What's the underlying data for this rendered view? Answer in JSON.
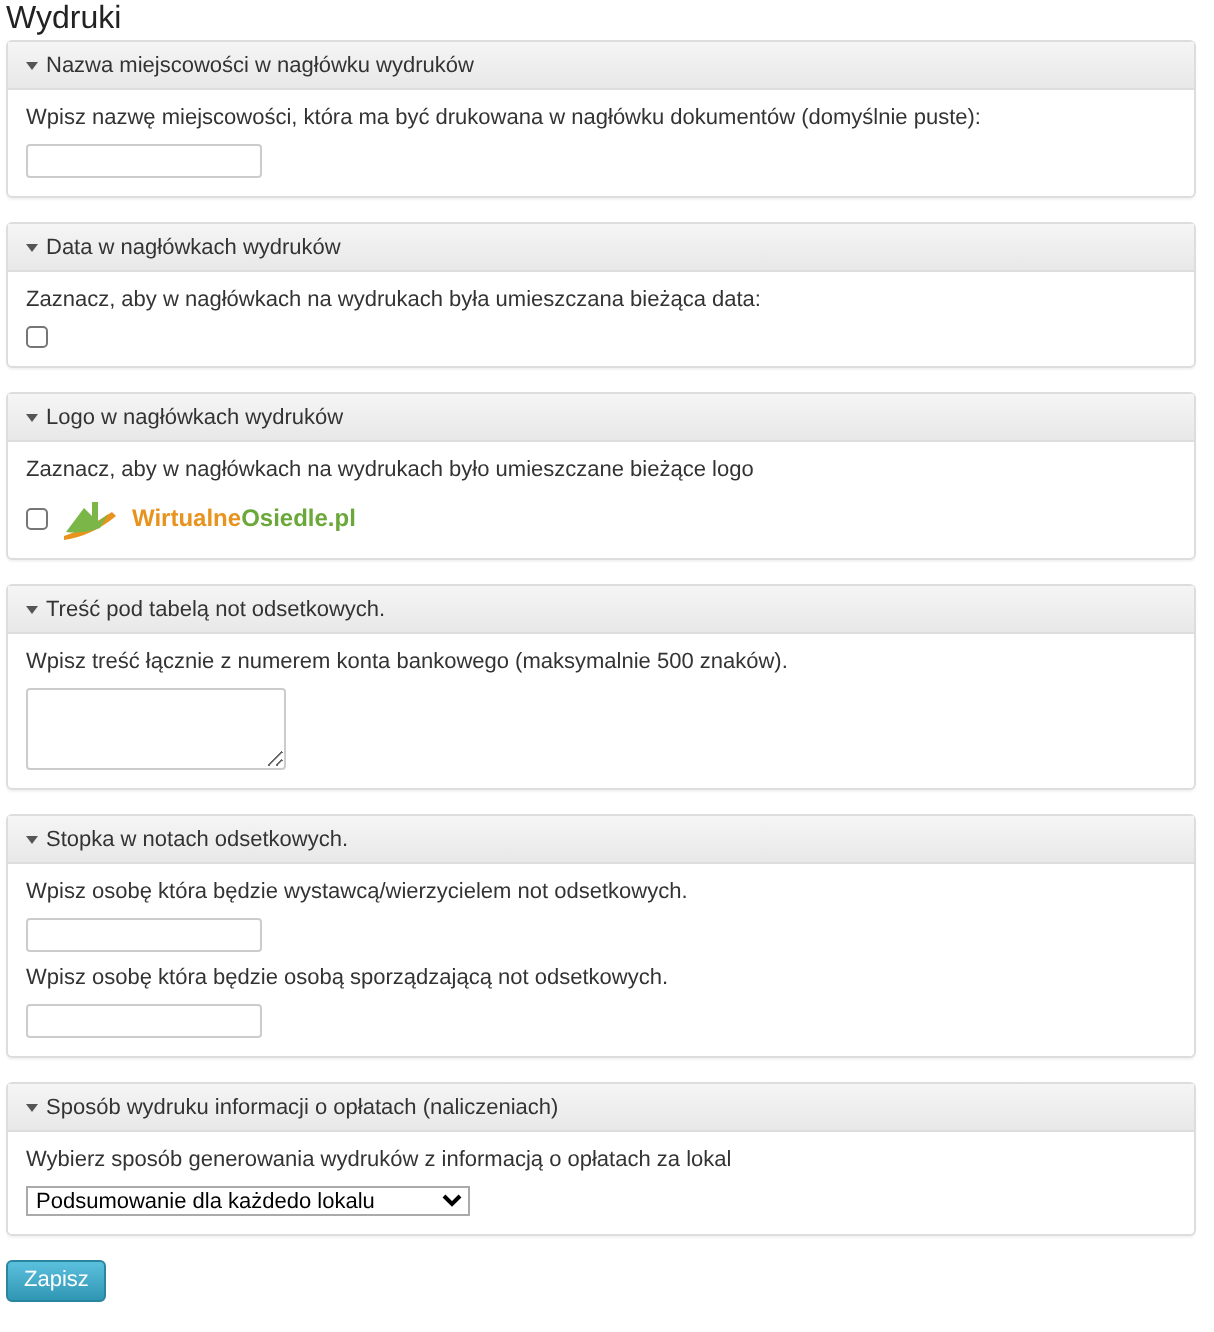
{
  "title": "Wydruki",
  "panels": [
    {
      "title": "Nazwa miejscowości w nagłówku wydruków",
      "expanded": true,
      "items": [
        {
          "kind": "label",
          "text": "Wpisz nazwę miejscowości, która ma być drukowana w nagłówku dokumentów (domyślnie puste):"
        },
        {
          "kind": "text_input"
        }
      ]
    },
    {
      "title": "Data w nagłówkach wydruków",
      "expanded": true,
      "items": [
        {
          "kind": "label",
          "text": "Zaznacz, aby w nagłówkach na wydrukach była umieszczana bieżąca data:"
        },
        {
          "kind": "checkbox",
          "checked": false
        }
      ]
    },
    {
      "title": "Logo w nagłówkach wydruków",
      "expanded": true,
      "items": [
        {
          "kind": "label",
          "text": "Zaznacz, aby w nagłówkach na wydrukach było umieszczane bieżące logo"
        },
        {
          "kind": "checkbox",
          "checked": false,
          "logo": {
            "first": "Wirtualne",
            "second": "Osiedle.pl"
          }
        }
      ]
    },
    {
      "title": "Treść pod tabelą not odsetkowych.",
      "expanded": true,
      "items": [
        {
          "kind": "label",
          "text": "Wpisz treść łącznie z numerem konta bankowego (maksymalnie 500 znaków)."
        },
        {
          "kind": "textarea"
        }
      ]
    },
    {
      "title": "Stopka w notach odsetkowych.",
      "expanded": true,
      "items": [
        {
          "kind": "label",
          "text": "Wpisz osobę która będzie wystawcą/wierzycielem not odsetkowych."
        },
        {
          "kind": "text_input"
        },
        {
          "kind": "label",
          "text": "Wpisz osobę która będzie osobą sporządzającą not odsetkowych."
        },
        {
          "kind": "text_input"
        }
      ]
    },
    {
      "title": "Sposób wydruku informacji o opłatach (naliczeniach)",
      "expanded": true,
      "items": [
        {
          "kind": "label",
          "text": "Wybierz sposób generowania wydruków z informacją o opłatach za lokal"
        },
        {
          "kind": "select",
          "value": "Podsumowanie dla każdedo lokalu"
        }
      ]
    }
  ],
  "save_button": "Zapisz"
}
